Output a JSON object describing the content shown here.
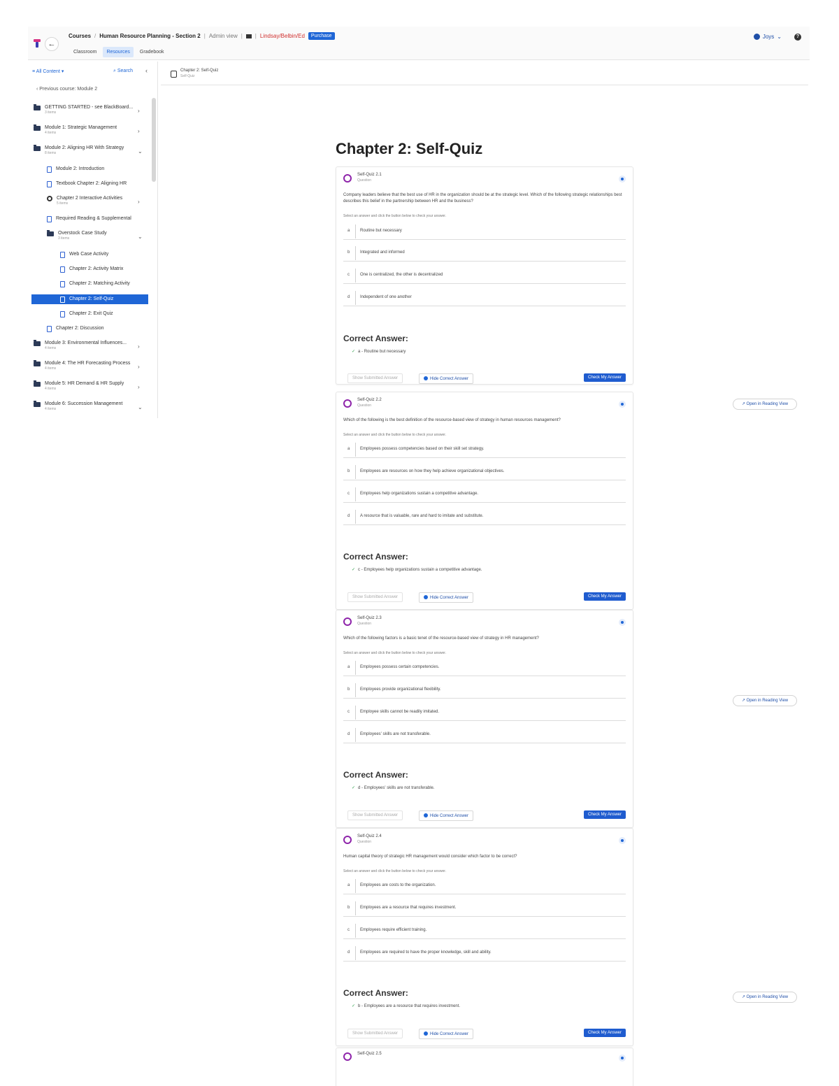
{
  "header": {
    "breadcrumbs": [
      "Courses",
      "Human Resource Planning - Section 2",
      "Admin view",
      "Lindsay/Belbin/Ed",
      "Purchase"
    ],
    "tabs": [
      "Classroom",
      "Resources",
      "Gradebook"
    ],
    "active_tab": "Resources",
    "user_label": "Joys",
    "back_icon": "arrow-left-icon",
    "help_icon": "help-icon"
  },
  "sidebar": {
    "filter_label": "All Content",
    "search_label": "Search",
    "prev_label": "Previous course: Module 2",
    "items": [
      {
        "label": "GETTING STARTED - see BlackBoard...",
        "meta": "3 items",
        "icon": "folder-icon"
      },
      {
        "label": "Module 1: Strategic Management",
        "meta": "4 items",
        "icon": "folder-icon"
      },
      {
        "label": "Module 2: Aligning HR With Strategy",
        "meta": "8 items",
        "icon": "folder-icon"
      },
      {
        "label": "Module 2: Introduction",
        "meta": "",
        "icon": "doc-icon"
      },
      {
        "label": "Textbook Chapter 2: Aligning HR",
        "meta": "",
        "icon": "doc-icon"
      },
      {
        "label": "Chapter 2 Interactive Activities",
        "meta": "5 items",
        "icon": "gear-icon"
      },
      {
        "label": "Required Reading & Supplemental",
        "meta": "",
        "icon": "doc-icon"
      },
      {
        "label": "Overstock Case Study",
        "meta": "3 items",
        "icon": "folder-icon"
      },
      {
        "label": "Web Case Activity",
        "meta": "",
        "icon": "doc-icon"
      },
      {
        "label": "Chapter 2: Activity Matrix",
        "meta": "",
        "icon": "doc-icon"
      },
      {
        "label": "Chapter 2: Matching Activity",
        "meta": "",
        "icon": "doc-icon"
      },
      {
        "label": "Chapter 2: Self-Quiz",
        "meta": "",
        "icon": "doc-icon"
      },
      {
        "label": "Chapter 2: Exit Quiz",
        "meta": "",
        "icon": "doc-icon"
      },
      {
        "label": "Chapter 2: Discussion",
        "meta": "",
        "icon": "doc-icon"
      },
      {
        "label": "Module 3: Environmental Influences...",
        "meta": "4 items",
        "icon": "folder-icon"
      },
      {
        "label": "Module 4: The HR Forecasting Process",
        "meta": "4 items",
        "icon": "folder-icon"
      },
      {
        "label": "Module 5: HR Demand & HR Supply",
        "meta": "4 items",
        "icon": "folder-icon"
      },
      {
        "label": "Module 6: Succession Management",
        "meta": "4 items",
        "icon": "folder-icon"
      }
    ]
  },
  "main": {
    "head_title": "Chapter 2: Self-Quiz",
    "head_sub": "Self-Quiz",
    "page_title": "Chapter 2: Self-Quiz",
    "instruction": "Select an answer and click the button below to check your answer.",
    "correct_heading": "Correct Answer:",
    "show_label": "Show Submitted Answer",
    "hide_label": "Hide Correct Answer",
    "check_label": "Check My Answer",
    "reading_label": "Open in Reading View",
    "quizzes": [
      {
        "title": "Self-Quiz 2.1",
        "sub": "Question",
        "question": "Company leaders believe that the best use of HR in the organization should be at the strategic level. Which of the following strategic relationships best describes this belief in the partnership between HR and the business?",
        "options": [
          {
            "letter": "a",
            "text": "Routine but necessary"
          },
          {
            "letter": "b",
            "text": "Integrated and informed"
          },
          {
            "letter": "c",
            "text": "One is centralized, the other is decentralized"
          },
          {
            "letter": "d",
            "text": "Independent of one another"
          }
        ],
        "answer": "a - Routine but necessary"
      },
      {
        "title": "Self-Quiz 2.2",
        "sub": "Question",
        "question": "Which of the following is the best definition of the resource-based view of strategy in human resources management?",
        "options": [
          {
            "letter": "a",
            "text": "Employees possess competencies based on their skill set strategy."
          },
          {
            "letter": "b",
            "text": "Employees are resources on how they help achieve organizational objectives."
          },
          {
            "letter": "c",
            "text": "Employees help organizations sustain a competitive advantage."
          },
          {
            "letter": "d",
            "text": "A resource that is valuable, rare and hard to imitate and substitute."
          }
        ],
        "answer": "c - Employees help organizations sustain a competitive advantage."
      },
      {
        "title": "Self-Quiz 2.3",
        "sub": "Question",
        "question": "Which of the following factors is a basic tenet of the resource-based view of strategy in HR management?",
        "options": [
          {
            "letter": "a",
            "text": "Employees possess certain competencies."
          },
          {
            "letter": "b",
            "text": "Employees provide organizational flexibility."
          },
          {
            "letter": "c",
            "text": "Employee skills cannot be readily imitated."
          },
          {
            "letter": "d",
            "text": "Employees' skills are not transferable."
          }
        ],
        "answer": "d - Employees' skills are not transferable."
      },
      {
        "title": "Self-Quiz 2.4",
        "sub": "Question",
        "question": "Human capital theory of strategic HR management would consider which factor to be correct?",
        "options": [
          {
            "letter": "a",
            "text": "Employees are costs to the organization."
          },
          {
            "letter": "b",
            "text": "Employees are a resource that requires investment."
          },
          {
            "letter": "c",
            "text": "Employees require efficient training."
          },
          {
            "letter": "d",
            "text": "Employees are required to have the proper knowledge, skill and ability."
          }
        ],
        "answer": "b - Employees are a resource that requires investment."
      }
    ],
    "next_quiz_title": "Self-Quiz 2.5"
  }
}
